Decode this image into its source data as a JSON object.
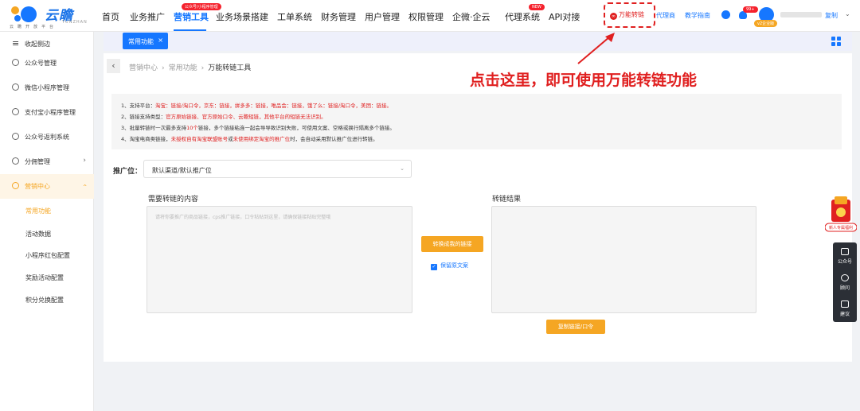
{
  "brand": {
    "name": "云瞻",
    "name_en": "YUNZHAN",
    "slogan": "云瞻开放平台",
    "colors": {
      "primary": "#1677ff",
      "accent": "#f5a623",
      "annotation": "#e02020"
    }
  },
  "topnav": {
    "items": [
      {
        "label": "首页"
      },
      {
        "label": "业务推广"
      },
      {
        "label": "营销工具",
        "badge": "公众号/小程序管理"
      },
      {
        "label": "业务场景搭建"
      },
      {
        "label": "工单系统"
      },
      {
        "label": "财务管理"
      },
      {
        "label": "用户管理"
      },
      {
        "label": "权限管理"
      },
      {
        "label": "企微·企云"
      },
      {
        "label": "代理系统",
        "badge": "NEW"
      },
      {
        "label": "API对接"
      }
    ],
    "active_index": 2,
    "quick_tool": "万能转链",
    "agent_link": "代理商",
    "guide_link": "教学指南",
    "notification_count": "99+",
    "vip_badge": "v2企业版",
    "copy_label": "复制",
    "icons": [
      "user-group-icon",
      "bell-icon",
      "avatar-icon",
      "chevron-down-icon"
    ]
  },
  "sidebar": {
    "collapse_label": "收起侧边",
    "items": [
      {
        "label": "公众号管理",
        "icon": "wechat-icon"
      },
      {
        "label": "微信小程序管理",
        "icon": "miniapp-icon"
      },
      {
        "label": "支付宝小程序管理",
        "icon": "alipay-icon"
      },
      {
        "label": "公众号返利系统",
        "icon": "rebate-icon"
      },
      {
        "label": "分佣管理",
        "icon": "commission-icon",
        "caret": "›"
      },
      {
        "label": "营销中心",
        "icon": "gift-icon",
        "caret": "‹",
        "open": true
      }
    ],
    "sub_items": [
      {
        "label": "常用功能",
        "active": true
      },
      {
        "label": "活动数据"
      },
      {
        "label": "小程序红包配置"
      },
      {
        "label": "奖励活动配置"
      },
      {
        "label": "积分兑换配置"
      }
    ]
  },
  "tabs": {
    "active_tab": "常用功能",
    "close_icon": "×"
  },
  "breadcrumb": {
    "back_icon": "‹",
    "items": [
      "营销中心",
      "常用功能",
      "万能转链工具"
    ],
    "sep": "›"
  },
  "annotation": {
    "text": "点击这里，即可使用万能转链功能"
  },
  "notice": {
    "lines": [
      [
        {
          "t": "1、支持平台："
        },
        {
          "t": "淘宝：链接/淘口令，京东：链接，拼多多：链接，唯品会：链接，饿了么：链接/淘口令，美团：链接。",
          "red": true
        }
      ],
      [
        {
          "t": "2、链接支持类型："
        },
        {
          "t": "官方原始链接、官方原始口令、云瞻短链，其他平台的短链无法识别。",
          "red": true
        }
      ],
      [
        {
          "t": "3、批量转链时一次最多支持"
        },
        {
          "t": "10个",
          "red": true
        },
        {
          "t": "链接，多个链接粘连一起会导导致识别失败，可使用文案、空格或换行隔离多个链接。"
        }
      ],
      [
        {
          "t": "4、淘宝电商类链接，"
        },
        {
          "t": "未授权自有淘宝联盟账号",
          "red": true
        },
        {
          "t": "或"
        },
        {
          "t": "未使用绑定淘宝的推广位",
          "red": true
        },
        {
          "t": "时，会自动采用默认推广位进行转链。"
        }
      ]
    ]
  },
  "form": {
    "promo_label": "推广位：",
    "promo_value": "默认渠道/默认推广位",
    "input_label": "需要转链的内容",
    "input_placeholder": "请将你要推广的商品链接，cps推广链接，口令粘贴到这里，请确保链接粘贴完整哦",
    "result_label": "转链结果",
    "convert_button": "转换成我的链接",
    "keep_text_label": "保留原文案",
    "copy_button": "复制链接/口令"
  },
  "float_panel": {
    "promo_text": "新人专属福利",
    "items": [
      {
        "label": "公众号",
        "icon": "wechat-qr-icon"
      },
      {
        "label": "顾问",
        "icon": "headset-icon"
      },
      {
        "label": "建议",
        "icon": "edit-icon"
      }
    ]
  }
}
